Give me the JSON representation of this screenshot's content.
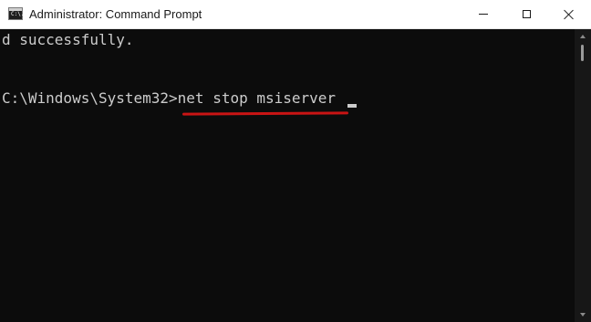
{
  "window": {
    "title": "Administrator: Command Prompt",
    "app_icon": "command-prompt-icon",
    "app_icon_glyph": "C:\\."
  },
  "caption_buttons": {
    "minimize_icon": "minimize-icon",
    "maximize_icon": "maximize-icon",
    "close_icon": "close-icon"
  },
  "console": {
    "lines": [
      "d successfully.",
      "C:\\Windows\\System32>net stop msiserver"
    ],
    "prompt": "C:\\Windows\\System32>",
    "command": "net stop msiserver",
    "text_color": "#cccccc",
    "background_color": "#0c0c0c"
  },
  "annotation": {
    "underline_color": "#c91414"
  },
  "scrollbar": {
    "up_icon": "scroll-up-arrow-icon",
    "down_icon": "scroll-down-arrow-icon"
  }
}
